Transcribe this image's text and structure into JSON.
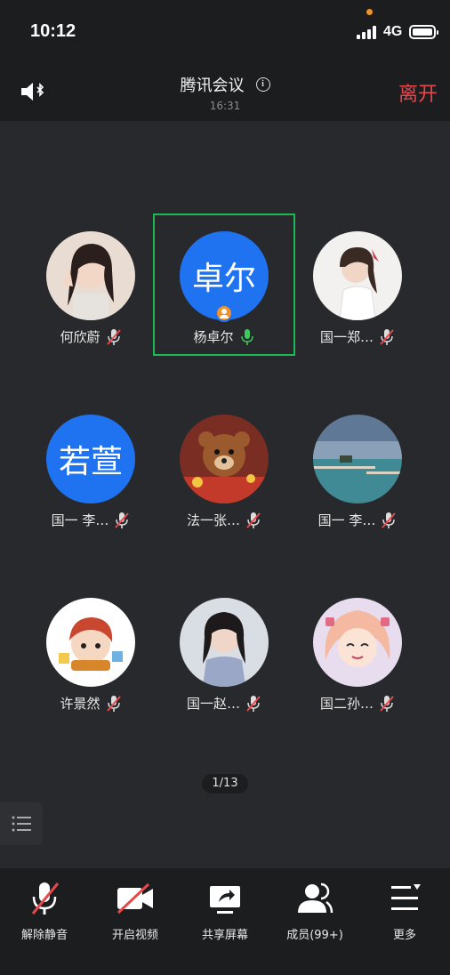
{
  "status_bar": {
    "time": "10:12",
    "network": "4G"
  },
  "header": {
    "title": "腾讯会议",
    "meeting_time": "16:31",
    "leave_label": "离开"
  },
  "participants": [
    {
      "name": "何欣蔚",
      "muted": true
    },
    {
      "name": "杨卓尔",
      "avatar_text": "卓尔",
      "muted": false,
      "speaking": true
    },
    {
      "name": "国一郑…",
      "muted": true
    },
    {
      "name": "国一 李…",
      "avatar_text": "若萱",
      "muted": true
    },
    {
      "name": "法一张…",
      "muted": true
    },
    {
      "name": "国一 李…",
      "muted": true
    },
    {
      "name": "许景然",
      "muted": true
    },
    {
      "name": "国一赵…",
      "muted": true
    },
    {
      "name": "国二孙…",
      "muted": true
    }
  ],
  "pager": "1/13",
  "toolbar": {
    "unmute": "解除静音",
    "video": "开启视频",
    "share": "共享屏幕",
    "members": "成员(99+)",
    "more": "更多"
  },
  "colors": {
    "accent_blue": "#1f72f0",
    "active_border": "#1db954",
    "leave_red": "#e5484d",
    "mute_red": "#e5484d"
  }
}
